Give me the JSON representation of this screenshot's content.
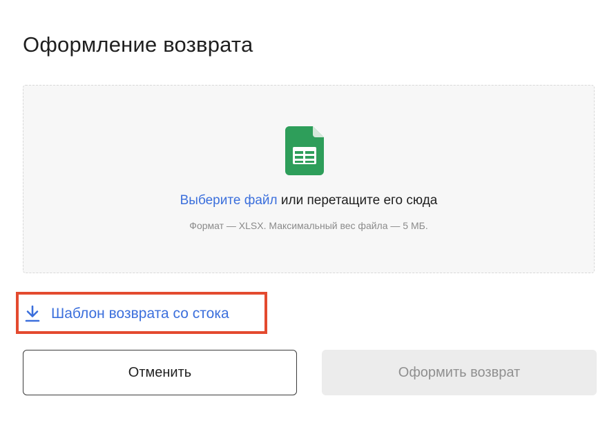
{
  "dialog": {
    "title": "Оформление возврата"
  },
  "dropzone": {
    "icon": "spreadsheet-file-icon",
    "select_link": "Выберите файл",
    "drag_text": " или перетащите его сюда",
    "hint": "Формат — XLSX. Максимальный вес файла — 5 МБ."
  },
  "template_link": {
    "icon": "download-icon",
    "label": "Шаблон возврата со стока"
  },
  "buttons": {
    "cancel": "Отменить",
    "submit": "Оформить возврат"
  },
  "colors": {
    "accent_blue": "#3b6fdc",
    "highlight_red": "#e34a2f",
    "file_icon_green": "#2e9e5a",
    "disabled_bg": "#ececec"
  }
}
